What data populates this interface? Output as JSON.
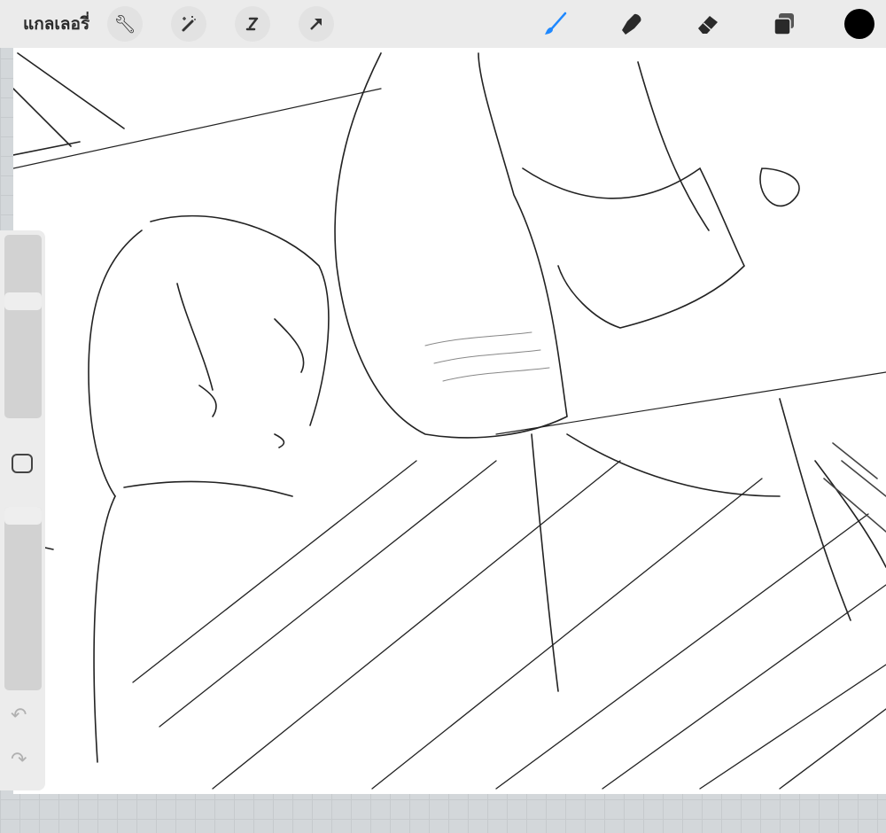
{
  "topbar": {
    "gallery_label": "แกลเลอรี่",
    "tools_left": [
      {
        "icon": "wrench-icon"
      },
      {
        "icon": "magic-wand-icon"
      },
      {
        "icon": "selection-icon"
      },
      {
        "icon": "transform-arrow-icon"
      }
    ],
    "tools_right": [
      {
        "icon": "brush-icon",
        "active": true
      },
      {
        "icon": "smudge-icon"
      },
      {
        "icon": "eraser-icon"
      },
      {
        "icon": "layers-icon"
      }
    ],
    "current_color": "#000000",
    "accent": "#1e88ff"
  },
  "sidebar": {
    "brush_size": 0.65,
    "opacity": 1.0
  }
}
